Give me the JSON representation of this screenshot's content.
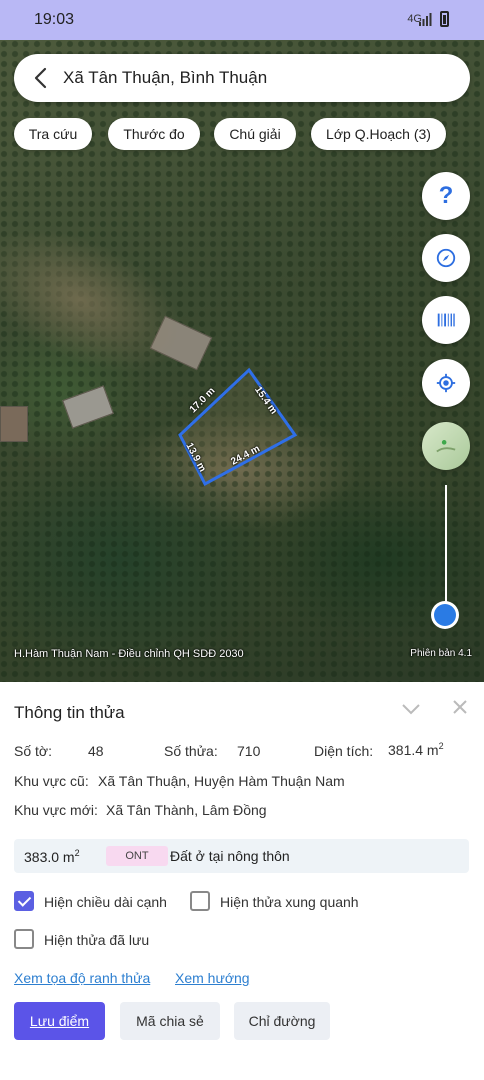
{
  "status_bar": {
    "time": "19:03",
    "network": "4G"
  },
  "search": {
    "title": "Xã Tân Thuận, Bình Thuận"
  },
  "chips": [
    "Tra cứu",
    "Thước đo",
    "Chú giải",
    "Lớp Q.Hoạch (3)"
  ],
  "map": {
    "dimensions": [
      "17.0 m",
      "15.4 m",
      "13.9 m",
      "24.4 m"
    ],
    "caption": "H.Hàm Thuận Nam - Điều chỉnh QH SDĐ 2030",
    "version": "Phiên bản 4.1",
    "help_symbol": "?",
    "zoom_level": 0.05
  },
  "panel": {
    "title": "Thông tin thửa",
    "so_to_label": "Số tờ:",
    "so_to_value": "48",
    "so_thua_label": "Số thửa:",
    "so_thua_value": "710",
    "dien_tich_label": "Diện tích:",
    "dien_tich_value": "381.4 m",
    "area_unit_sup": "2",
    "old_area_label": "Khu vực cũ:",
    "old_area_value": "Xã Tân Thuận, Huyện Hàm Thuận Nam",
    "new_area_label": "Khu vực mới:",
    "new_area_value": "Xã Tân Thành, Lâm Đồng",
    "land_area": "383.0 m",
    "land_code": "ONT",
    "land_type": "Đất ở tại nông thôn",
    "checkboxes": [
      {
        "label": "Hiện chiều dài cạnh",
        "checked": true
      },
      {
        "label": "Hiện thửa xung quanh",
        "checked": false
      },
      {
        "label": "Hiện thửa đã lưu",
        "checked": false
      }
    ],
    "link_coords": "Xem tọa độ ranh thửa",
    "link_direction": "Xem hướng",
    "btn_save": "Lưu điểm",
    "btn_share": "Mã chia sẻ",
    "btn_route": "Chỉ đường"
  },
  "colors": {
    "accent": "#5b54e8",
    "parcel_outline": "#2f6fe8",
    "link": "#2d7fd0",
    "badge": "#f8d9f0"
  }
}
